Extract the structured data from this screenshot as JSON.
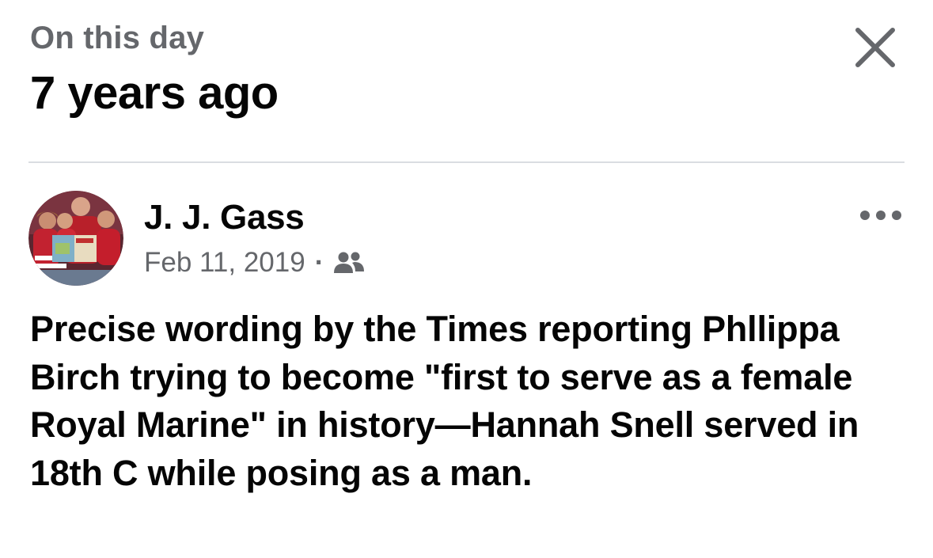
{
  "header": {
    "kicker": "On this day",
    "title": "7 years ago"
  },
  "post": {
    "author": "J. J. Gass",
    "date": "Feb 11, 2019",
    "separator": "·",
    "audience_icon": "friends-icon",
    "text": "Precise wording by the Times reporting Phllippa Birch trying to become \"first to serve as a female Royal Marine\" in history—Hannah Snell served in 18th C while posing as a man."
  },
  "icons": {
    "close": "close-icon",
    "more": "more-options-icon"
  },
  "colors": {
    "primary_text": "#050505",
    "secondary_text": "#65676b",
    "divider": "#dadde1"
  }
}
